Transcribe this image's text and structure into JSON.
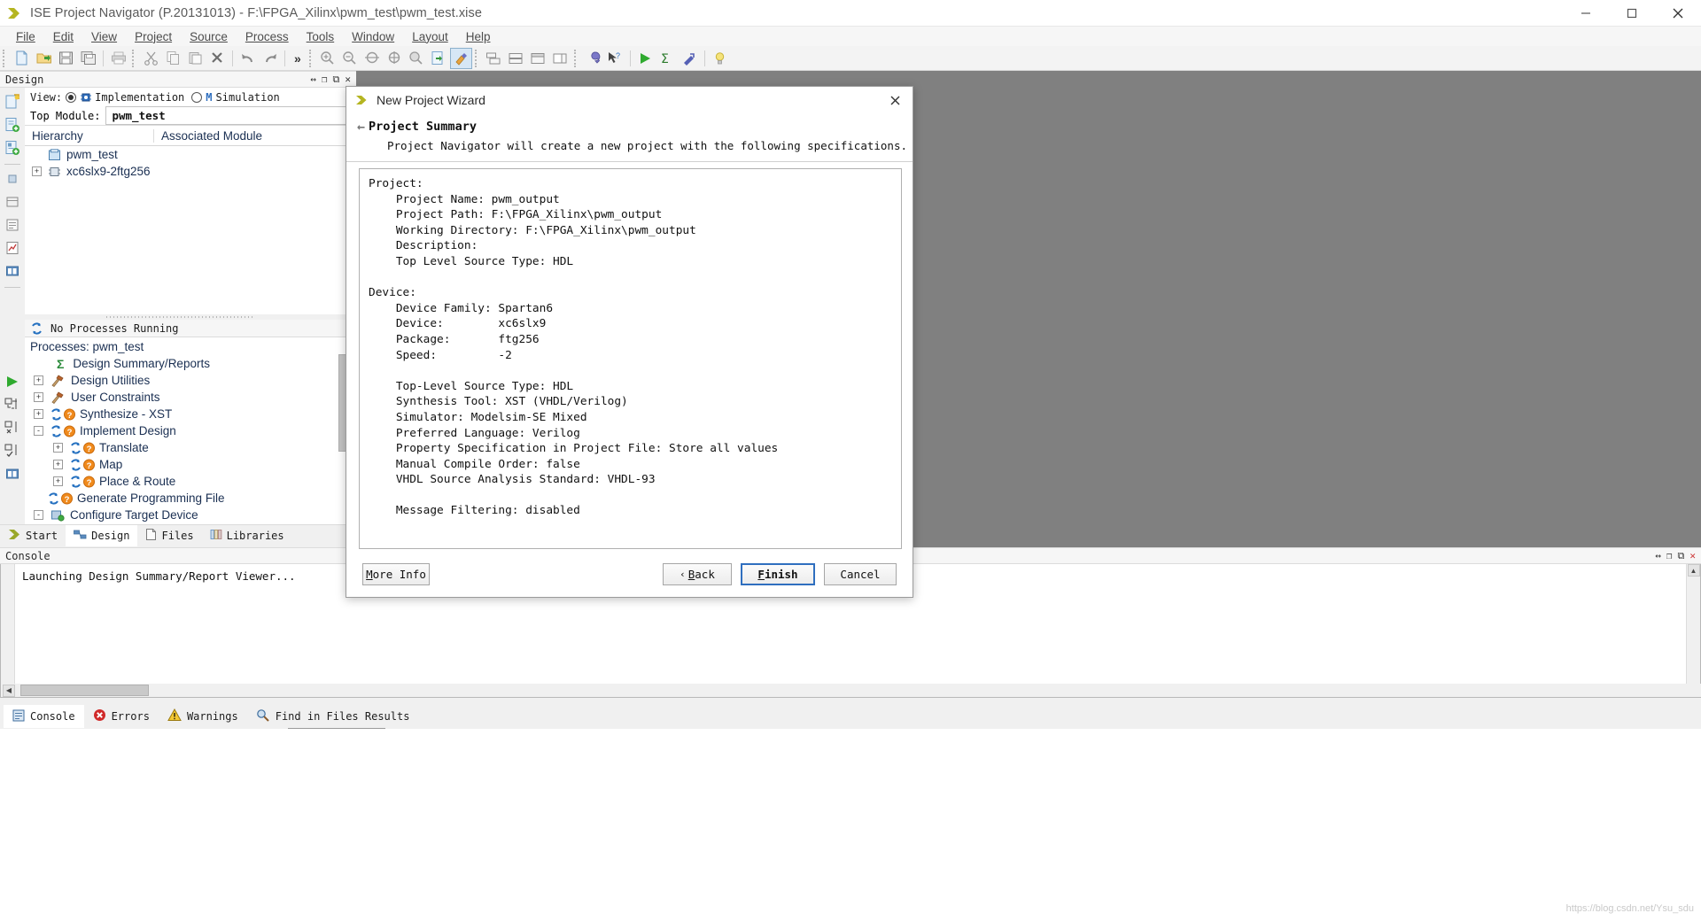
{
  "window": {
    "title": "ISE Project Navigator (P.20131013) - F:\\FPGA_Xilinx\\pwm_test\\pwm_test.xise",
    "app_icon": "xilinx-chevron-icon",
    "minimize": "–",
    "maximize": "❐",
    "close": "✕"
  },
  "menubar": {
    "items": [
      {
        "label": "File",
        "mnemonic": "F"
      },
      {
        "label": "Edit",
        "mnemonic": "E"
      },
      {
        "label": "View",
        "mnemonic": "V"
      },
      {
        "label": "Project",
        "mnemonic": "P"
      },
      {
        "label": "Source",
        "mnemonic": "S"
      },
      {
        "label": "Process",
        "mnemonic": "r"
      },
      {
        "label": "Tools",
        "mnemonic": "T"
      },
      {
        "label": "Window",
        "mnemonic": "W"
      },
      {
        "label": "Layout",
        "mnemonic": "L"
      },
      {
        "label": "Help",
        "mnemonic": "H"
      }
    ]
  },
  "toolbar": {
    "groups": [
      [
        "new-file-icon",
        "open-folder-icon",
        "save-icon",
        "save-all-icon"
      ],
      [
        "print-icon"
      ],
      [
        "cut-icon",
        "copy-icon",
        "paste-icon",
        "delete-icon"
      ],
      [
        "undo-icon",
        "redo-icon"
      ],
      [
        "overflow-chevron-icon"
      ],
      [
        "zoom-in-icon",
        "zoom-out-icon",
        "zoom-fit-icon",
        "zoom-selection-icon",
        "pan-icon",
        "export-image-icon",
        "highlight-icon"
      ],
      [
        "tile-horizontal-icon",
        "tile-vertical-icon",
        "split-top-icon",
        "split-left-icon"
      ],
      [
        "settings-wrench-icon",
        "context-help-icon"
      ],
      [
        "run-icon",
        "design-summary-icon",
        "implement-icon"
      ],
      [
        "lightbulb-icon"
      ]
    ]
  },
  "design_panel": {
    "header": "Design",
    "header_controls": [
      "resize-icon",
      "float-icon",
      "dock-icon",
      "close-icon"
    ],
    "view_label": "View:",
    "view_options": [
      {
        "label": "Implementation",
        "icon": "chip-icon",
        "selected": true
      },
      {
        "label": "Simulation",
        "icon": "modelsim-m-icon",
        "selected": false
      }
    ],
    "top_module_label": "Top Module:",
    "top_module_value": "pwm_test",
    "tree_columns": [
      "Hierarchy",
      "Associated Module"
    ],
    "tree_items": [
      {
        "label": "pwm_test",
        "icon": "project-icon",
        "indent": 1,
        "expander": ""
      },
      {
        "label": "xc6slx9-2ftg256",
        "icon": "device-chip-icon",
        "indent": 0,
        "expander": "+"
      }
    ]
  },
  "processes_panel": {
    "status": "No Processes Running",
    "status_icon": "refresh-arrows-icon",
    "title": "Processes: pwm_test",
    "items": [
      {
        "label": "Design Summary/Reports",
        "icon": "sigma-icon",
        "expander": "",
        "indent": 0,
        "badge": ""
      },
      {
        "label": "Design Utilities",
        "icon": "hammer-icon",
        "expander": "+",
        "indent": 0,
        "badge": ""
      },
      {
        "label": "User Constraints",
        "icon": "hammer-icon",
        "expander": "+",
        "indent": 0,
        "badge": ""
      },
      {
        "label": "Synthesize - XST",
        "icon": "refresh-arrows-icon",
        "expander": "+",
        "indent": 0,
        "badge": "question"
      },
      {
        "label": "Implement Design",
        "icon": "refresh-arrows-icon",
        "expander": "-",
        "indent": 0,
        "badge": "question"
      },
      {
        "label": "Translate",
        "icon": "refresh-arrows-icon",
        "expander": "+",
        "indent": 1,
        "badge": "question"
      },
      {
        "label": "Map",
        "icon": "refresh-arrows-icon",
        "expander": "+",
        "indent": 1,
        "badge": "question"
      },
      {
        "label": "Place & Route",
        "icon": "refresh-arrows-icon",
        "expander": "+",
        "indent": 1,
        "badge": "question"
      },
      {
        "label": "Generate Programming File",
        "icon": "refresh-arrows-icon",
        "expander": "",
        "indent": 0,
        "badge": "question"
      },
      {
        "label": "Configure Target Device",
        "icon": "config-device-icon",
        "expander": "-",
        "indent": 0,
        "badge": ""
      }
    ]
  },
  "left_tabs": [
    {
      "label": "Start",
      "icon": "start-arrow-icon",
      "active": false
    },
    {
      "label": "Design",
      "icon": "design-icon",
      "active": true
    },
    {
      "label": "Files",
      "icon": "files-icon",
      "active": false
    },
    {
      "label": "Libraries",
      "icon": "libraries-icon",
      "active": false
    }
  ],
  "console": {
    "header": "Console",
    "header_controls": [
      "resize-icon",
      "float-icon",
      "dock-icon",
      "close-icon"
    ],
    "lines": [
      "Launching Design Summary/Report Viewer..."
    ]
  },
  "bottom_tabs": [
    {
      "label": "Console",
      "icon": "console-icon",
      "active": true
    },
    {
      "label": "Errors",
      "icon": "error-icon",
      "active": false
    },
    {
      "label": "Warnings",
      "icon": "warning-icon",
      "active": false
    },
    {
      "label": "Find in Files Results",
      "icon": "find-icon",
      "active": false
    }
  ],
  "dialog": {
    "title": "New Project Wizard",
    "title_icon": "xilinx-chevron-icon",
    "close_icon": "✕",
    "heading": "Project Summary",
    "heading_arrow": "←",
    "subtitle": "Project Navigator will create a new project with the following specifications.",
    "summary_lines": [
      "Project:",
      "    Project Name: pwm_output",
      "    Project Path: F:\\FPGA_Xilinx\\pwm_output",
      "    Working Directory: F:\\FPGA_Xilinx\\pwm_output",
      "    Description:",
      "    Top Level Source Type: HDL",
      "",
      "Device:",
      "    Device Family: Spartan6",
      "    Device:        xc6slx9",
      "    Package:       ftg256",
      "    Speed:         -2",
      "",
      "    Top-Level Source Type: HDL",
      "    Synthesis Tool: XST (VHDL/Verilog)",
      "    Simulator: Modelsim-SE Mixed",
      "    Preferred Language: Verilog",
      "    Property Specification in Project File: Store all values",
      "    Manual Compile Order: false",
      "    VHDL Source Analysis Standard: VHDL-93",
      "",
      "    Message Filtering: disabled"
    ],
    "buttons": {
      "more_info": "More Info",
      "more_info_mnemonic": "M",
      "back": "Back",
      "back_mnemonic": "B",
      "back_arrow": "‹",
      "finish": "Finish",
      "finish_mnemonic": "F",
      "cancel": "Cancel"
    }
  },
  "watermark": "https://blog.csdn.net/Ysu_sdu",
  "colors": {
    "accent_blue": "#2f6fbf",
    "tree_text": "#1a2f52",
    "workarea_gray": "#808080",
    "xilinx_yellow": "#b5b521"
  }
}
